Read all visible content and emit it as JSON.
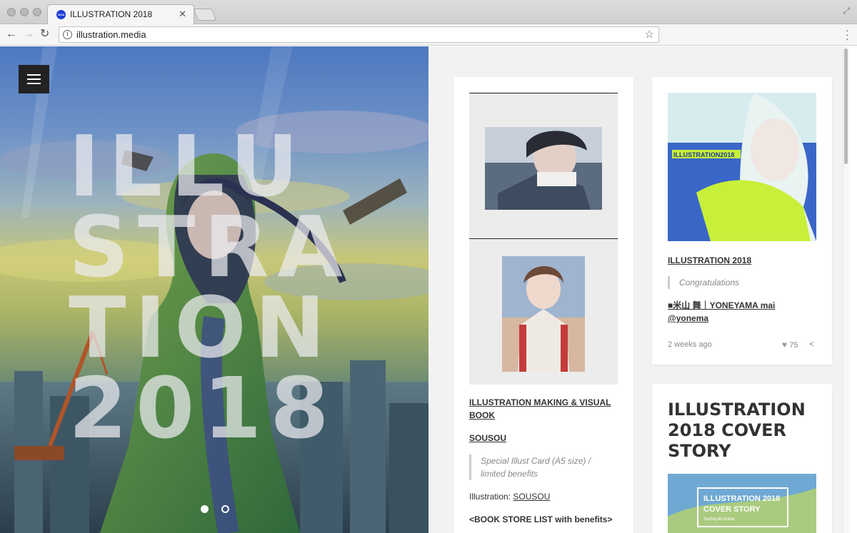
{
  "browser": {
    "tab_title": "ILLUSTRATION 2018",
    "url": "illustration.media",
    "favicon_text": "2018"
  },
  "hero": {
    "title_lines": "ILLU\nSTRA\nTION\n2018",
    "slide_count": 2,
    "active_slide": 1
  },
  "cards": {
    "making_book": {
      "title": "ILLUSTRATION MAKING & VISUAL BOOK",
      "artist": "SOUSOU",
      "quote": "Special Illust Card (A5 size) / limited benefits",
      "illustration_label": "Illustration: ",
      "illustration_artist": "SOUSOU",
      "store_list": "<BOOK STORE LIST with benefits>"
    },
    "illustration_2018": {
      "cover_label": "ILLUSTRATION2018",
      "title": "ILLUSTRATION 2018",
      "quote": "Congratulations",
      "artist": "■米山 舞｜YONEYAMA mai @yonema",
      "time": "2 weeks ago",
      "likes": "75"
    },
    "cover_story": {
      "heading": "ILLUSTRATION 2018 COVER STORY",
      "image_title_line1": "ILLUSTRATION 2018",
      "image_title_line2": "COVER STORY",
      "image_subtitle": "Sumayuki Arima"
    }
  },
  "colors": {
    "favicon_blue": "#1c3dd8",
    "hamburger_bg": "#222222",
    "page_bg": "#f2f2f2",
    "accent_green": "#c8f03a"
  }
}
